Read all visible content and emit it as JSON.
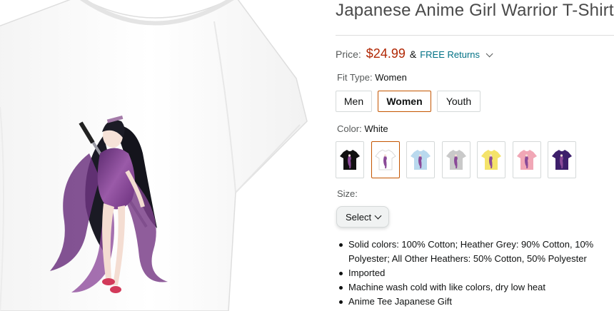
{
  "product": {
    "title": "Japanese Anime Girl Warrior T-Shirt",
    "price_label": "Price:",
    "price": "$24.99",
    "amp": "&",
    "free_returns": "FREE Returns",
    "fit_type": {
      "label": "Fit Type:",
      "selected": "Women",
      "options": [
        "Men",
        "Women",
        "Youth"
      ]
    },
    "color": {
      "label": "Color:",
      "selected": "White",
      "swatches": [
        {
          "name": "Black",
          "hex": "#111111"
        },
        {
          "name": "White",
          "hex": "#ffffff"
        },
        {
          "name": "Baby Blue",
          "hex": "#b9d9ee"
        },
        {
          "name": "Heather Grey",
          "hex": "#c9c9c9"
        },
        {
          "name": "Lemon",
          "hex": "#f4e36a"
        },
        {
          "name": "Pink",
          "hex": "#f1a7b6"
        },
        {
          "name": "Purple",
          "hex": "#3d1f6b"
        }
      ]
    },
    "size": {
      "label": "Size:",
      "select_value": "Select"
    },
    "bullets": [
      "Solid colors: 100% Cotton; Heather Grey: 90% Cotton, 10% Polyester; All Other Heathers: 50% Cotton, 50% Polyester",
      "Imported",
      "Machine wash cold with like colors, dry low heat",
      "Anime Tee Japanese Gift"
    ]
  },
  "colors": {
    "price": "#b12704",
    "link": "#007185",
    "selected_border": "#c45500",
    "kimono_purple": "#7a3f8a"
  }
}
